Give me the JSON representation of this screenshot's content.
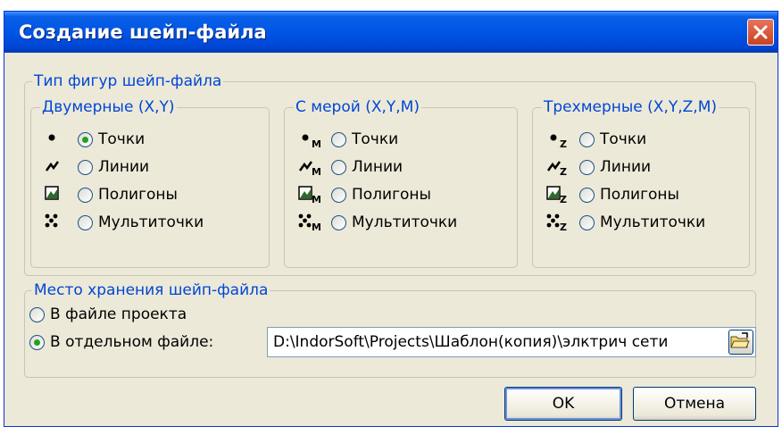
{
  "window": {
    "title": "Создание шейп-файла"
  },
  "shape_type": {
    "legend": "Тип фигур шейп-файла",
    "groups": [
      {
        "legend": "Двумерные (X,Y)",
        "options": [
          "Точки",
          "Линии",
          "Полигоны",
          "Мультиточки"
        ],
        "selected": 0
      },
      {
        "legend": "С мерой (X,Y,M)",
        "options": [
          "Точки",
          "Линии",
          "Полигоны",
          "Мультиточки"
        ],
        "selected": null
      },
      {
        "legend": "Трехмерные (X,Y,Z,M)",
        "options": [
          "Точки",
          "Линии",
          "Полигоны",
          "Мультиточки"
        ],
        "selected": null
      }
    ],
    "icon_subscripts": [
      "",
      "M",
      "Z"
    ]
  },
  "storage": {
    "legend": "Место хранения шейп-файла",
    "option_project": "В файле проекта",
    "option_separate": "В отдельном файле:",
    "selected": "separate",
    "path": "D:\\IndorSoft\\Projects\\Шаблон(копия)\\элктрич сети"
  },
  "buttons": {
    "ok": "OK",
    "cancel": "Отмена"
  },
  "colors": {
    "title_blue": "#0055e5",
    "legend_blue": "#0046d5",
    "radio_check": "#21a121",
    "dialog_bg": "#ece9d8",
    "close_red": "#c8431f"
  }
}
